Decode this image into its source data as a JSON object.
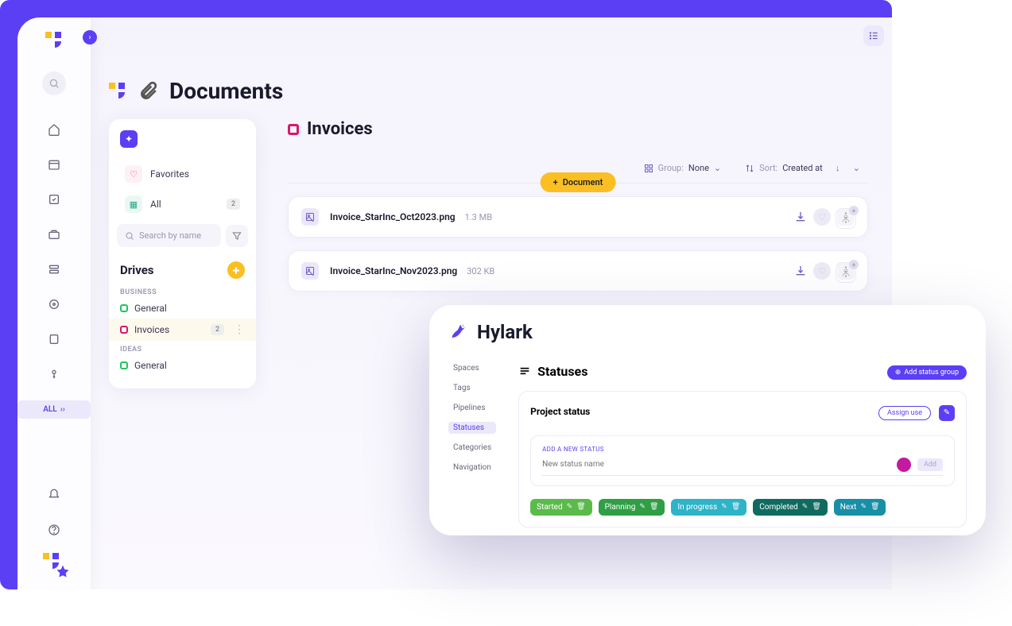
{
  "rail": {
    "all_label": "ALL"
  },
  "header": {
    "title": "Documents"
  },
  "panel": {
    "favorites": "Favorites",
    "all": "All",
    "all_count": "2",
    "search_placeholder": "Search by name",
    "drives_title": "Drives",
    "sections": {
      "business": {
        "label": "BUSINESS",
        "items": [
          {
            "name": "General",
            "color": "#22c55e"
          },
          {
            "name": "Invoices",
            "color": "#d6186a",
            "count": "2",
            "active": true
          }
        ]
      },
      "ideas": {
        "label": "IDEAS",
        "items": [
          {
            "name": "General",
            "color": "#22c55e"
          }
        ]
      }
    }
  },
  "main": {
    "title": "Invoices",
    "group_label": "Group:",
    "group_value": "None",
    "sort_label": "Sort:",
    "sort_value": "Created at",
    "add_doc": "Document",
    "docs": [
      {
        "name": "Invoice_StarInc_Oct2023.png",
        "size": "1.3 MB"
      },
      {
        "name": "Invoice_StarInc_Nov2023.png",
        "size": "302 KB"
      }
    ]
  },
  "overlay": {
    "brand": "Hylark",
    "nav": [
      "Spaces",
      "Tags",
      "Pipelines",
      "Statuses",
      "Categories",
      "Navigation"
    ],
    "nav_active": "Statuses",
    "title": "Statuses",
    "add_group": "Add status group",
    "panel": {
      "title": "Project status",
      "assign_use": "Assign use",
      "add_label": "ADD A NEW STATUS",
      "input_placeholder": "New status name",
      "add_btn": "Add",
      "chips": [
        {
          "label": "Started",
          "color": "#5bbb4a"
        },
        {
          "label": "Planning",
          "color": "#2f9e44"
        },
        {
          "label": "In progress",
          "color": "#2eb3c8"
        },
        {
          "label": "Completed",
          "color": "#0f6b5f"
        },
        {
          "label": "Next",
          "color": "#178fa6"
        }
      ]
    }
  }
}
